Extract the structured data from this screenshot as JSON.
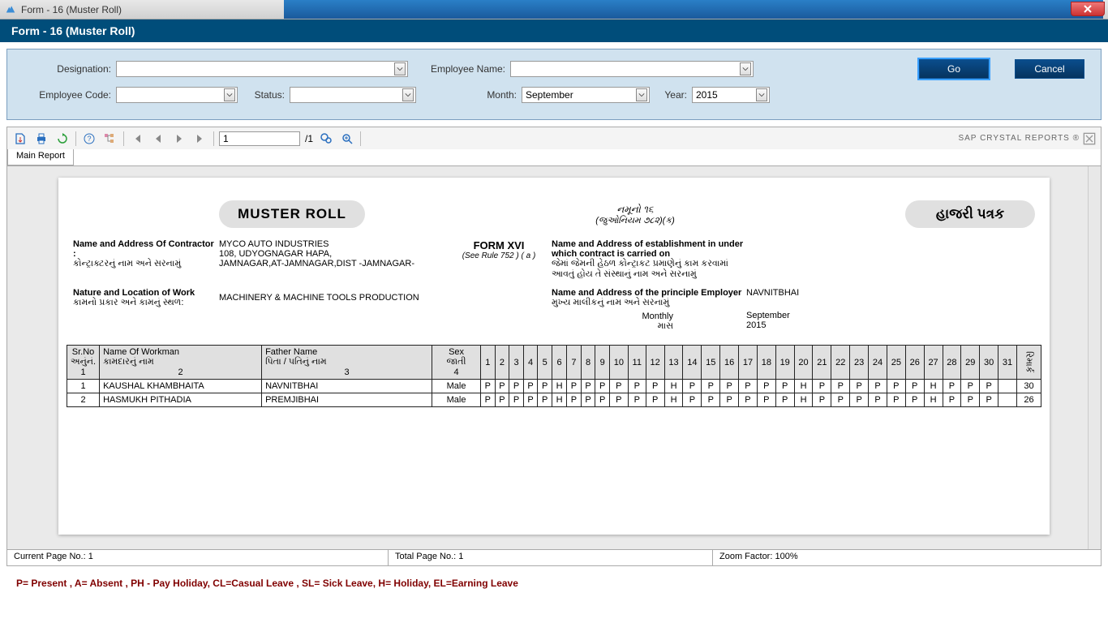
{
  "window": {
    "title": "Form - 16 (Muster Roll)"
  },
  "header": {
    "title": "Form - 16 (Muster Roll)"
  },
  "filters": {
    "designation_label": "Designation:",
    "employee_name_label": "Employee Name:",
    "employee_code_label": "Employee Code:",
    "status_label": "Status:",
    "month_label": "Month:",
    "month_value": "September",
    "year_label": "Year:",
    "year_value": "2015",
    "go": "Go",
    "cancel": "Cancel"
  },
  "toolbar": {
    "page_value": "1",
    "page_total": "/1",
    "cr_label": "SAP CRYSTAL REPORTS ®"
  },
  "tab": {
    "main": "Main Report"
  },
  "report": {
    "title_pill": "MUSTER ROLL",
    "guj_pill": "હાજરી પત્રક",
    "namuno": "નમૂનો ૧૬",
    "rulebracket": "(જુઓનિયમ ૭૮૨)(ક)",
    "formxvi": "FORM XVI",
    "seerule": "(See Rule 752 ) ( a )",
    "contractor_label": "Name and Address Of Contractor :",
    "contractor_guj": "કોન્ટ્રાક્ટરનું નામ અને સરનામું",
    "company_name": "MYCO AUTO INDUSTRIES",
    "company_addr1": "108, UDYOGNAGAR HAPA,",
    "company_addr2": "JAMNAGAR,AT-JAMNAGAR,DIST -JAMNAGAR-",
    "estab_label": "Name and Address of establishment in under which contract is carried on",
    "estab_guj1": "જેમાં જેમની હેઠળ કોન્ટ્રાકટ પ્રમાણેનું કામ કરવામાં",
    "estab_guj2": "આવતું હોય તે સંસ્થાનું નામ અને સરનામું",
    "nature_label": "Nature and Location of Work",
    "nature_guj": "કામનો પ્રકાર અને કામનું સ્થળ:",
    "nature_value": "MACHINERY & MACHINE TOOLS PRODUCTION",
    "emp_label": "Name and Address of the principle Employer",
    "emp_guj": "મુખ્ય માલીકનું નામ અને સરનામું",
    "emp_value": "NAVNITBHAI",
    "monthly_label": "Monthly",
    "monthly_guj": "માસ",
    "monthly_value": "September",
    "monthly_year": "2015",
    "cols": {
      "srno": "Sr.No",
      "srno_guj": "અનુંનં.",
      "srno_num": "1",
      "name": "Name Of Workman",
      "name_guj": "કામદારનું નામ",
      "name_num": "2",
      "father": "Father Name",
      "father_guj": "પિતા / પતિનું નામ",
      "father_num": "3",
      "sex": "Sex",
      "sex_guj": "જાતી",
      "sex_num": "4",
      "remark": "રિમાર્ક"
    },
    "rows": [
      {
        "sr": "1",
        "name": "KAUSHAL KHAMBHAITA",
        "father": "NAVNITBHAI",
        "sex": "Male",
        "days": [
          "P",
          "P",
          "P",
          "P",
          "P",
          "H",
          "P",
          "P",
          "P",
          "P",
          "P",
          "P",
          "H",
          "P",
          "P",
          "P",
          "P",
          "P",
          "P",
          "H",
          "P",
          "P",
          "P",
          "P",
          "P",
          "P",
          "H",
          "P",
          "P",
          "P",
          ""
        ],
        "total": "30"
      },
      {
        "sr": "2",
        "name": "HASMUKH PITHADIA",
        "father": "PREMJIBHAI",
        "sex": "Male",
        "days": [
          "P",
          "P",
          "P",
          "P",
          "P",
          "H",
          "P",
          "P",
          "P",
          "P",
          "P",
          "P",
          "H",
          "P",
          "P",
          "P",
          "P",
          "P",
          "P",
          "H",
          "P",
          "P",
          "P",
          "P",
          "P",
          "P",
          "H",
          "P",
          "P",
          "P",
          ""
        ],
        "total": "26"
      }
    ]
  },
  "status": {
    "current": "Current Page No.: 1",
    "total": "Total Page No.: 1",
    "zoom": "Zoom Factor: 100%"
  },
  "legend": "P= Present , A= Absent , PH - Pay Holiday, CL=Casual Leave , SL= Sick  Leave, H= Holiday, EL=Earning Leave"
}
